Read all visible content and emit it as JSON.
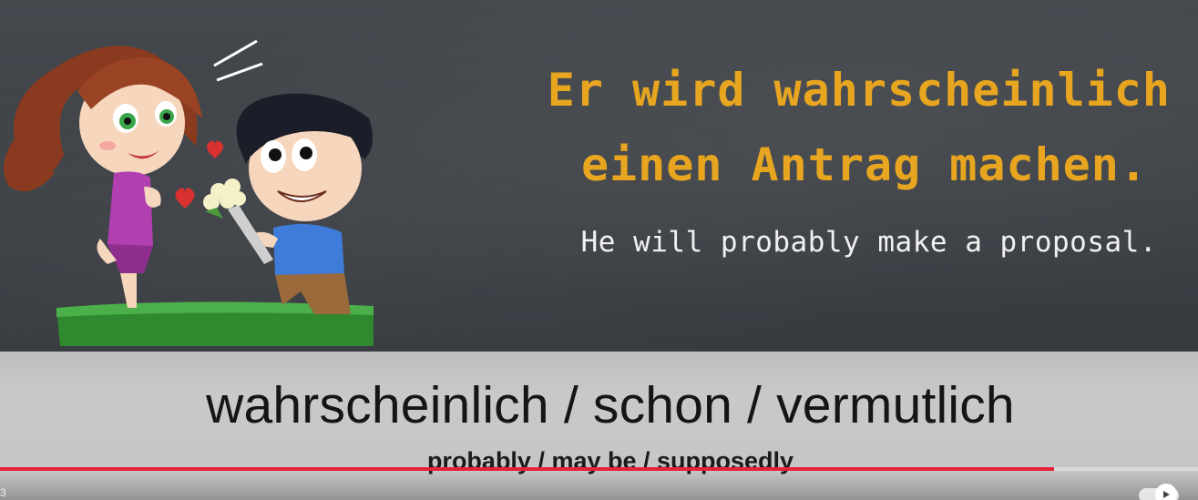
{
  "slide": {
    "german_line1": "Er wird wahrscheinlich",
    "german_line2": "einen Antrag machen.",
    "english": "He will probably make a proposal."
  },
  "caption": {
    "main": "wahrscheinlich / schon / vermutlich",
    "translation": "probably / may be / supposedly"
  },
  "player": {
    "time_fragment": "3",
    "progress_fraction": 0.88,
    "accent_color": "#e8203a",
    "autoplay_icon": "play-icon"
  },
  "colors": {
    "german_text": "#e8a51f",
    "english_text": "#f1f1f1",
    "chalkboard": "#3c4045"
  }
}
